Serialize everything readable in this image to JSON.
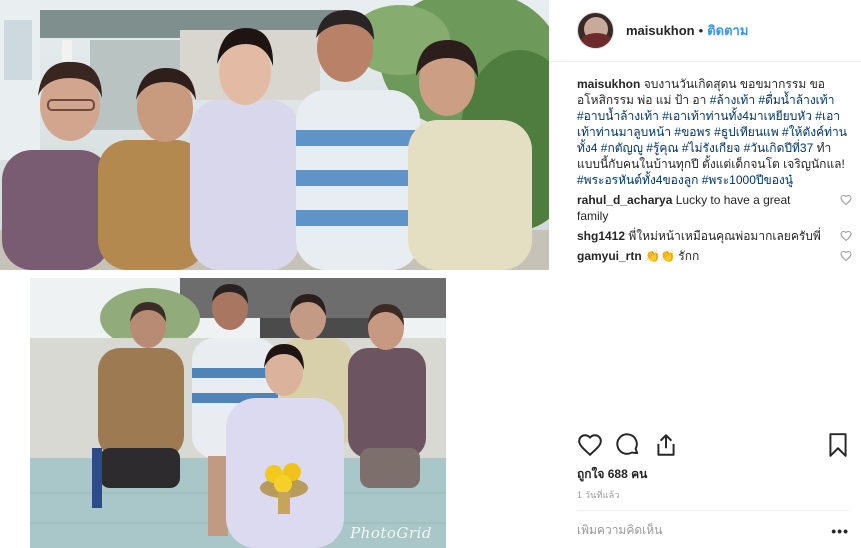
{
  "post": {
    "username": "maisukhon",
    "follow_label": "ติดตาม",
    "separator": "•"
  },
  "caption": {
    "text": "จบงานวันเกิดสุดน ขอขมากรรม ขออโหสิกรรม พ่อ แม่ ป้า อา",
    "hashtags_1": "#ล้างเท้า #ดื่มน้ำล้างเท้า #อาบน้ำล้างเท้า #เอาเท้าท่านทั้ง4มาเหยียบหัว #เอาเท้าท่านมาลูบหน้า #ขอพร #ธูปเทียนแพ #ให้ตังค์ท่านทั้ง4 #กตัญญู #รู้คุณ #ไม่รังเกียจ #วันเกิดปีที่37",
    "text_2": "ทำแบบนี้กับคนในบ้านทุกปี ตั้งแต่เด็กจนโต เจริญนักแล!",
    "hashtags_2": "#พระอรหันต์ทั้ง4ของลูก #พระ1000ปีของนู๋"
  },
  "comments": [
    {
      "user": "rahul_d_acharya",
      "text": "Lucky to have a great family"
    },
    {
      "user": "shg1412",
      "text": "พี่ใหม่หน้าเหมือนคุณพ่อมากเลยครับพี่"
    },
    {
      "user": "gamyui_rtn",
      "emoji": "👏👏",
      "text": "รักก"
    }
  ],
  "likes": "ถูกใจ 688 คน",
  "time": "1 วันที่แล้ว",
  "add_comment_placeholder": "เพิ่มความคิดเห็น",
  "more_label": "•••",
  "watermark": "PhotoGrid",
  "icons": [
    "heart-icon",
    "comment-icon",
    "share-icon",
    "bookmark-icon"
  ],
  "colors": {
    "link": "#3897f0",
    "hashtag": "#003569",
    "muted": "#999999"
  }
}
